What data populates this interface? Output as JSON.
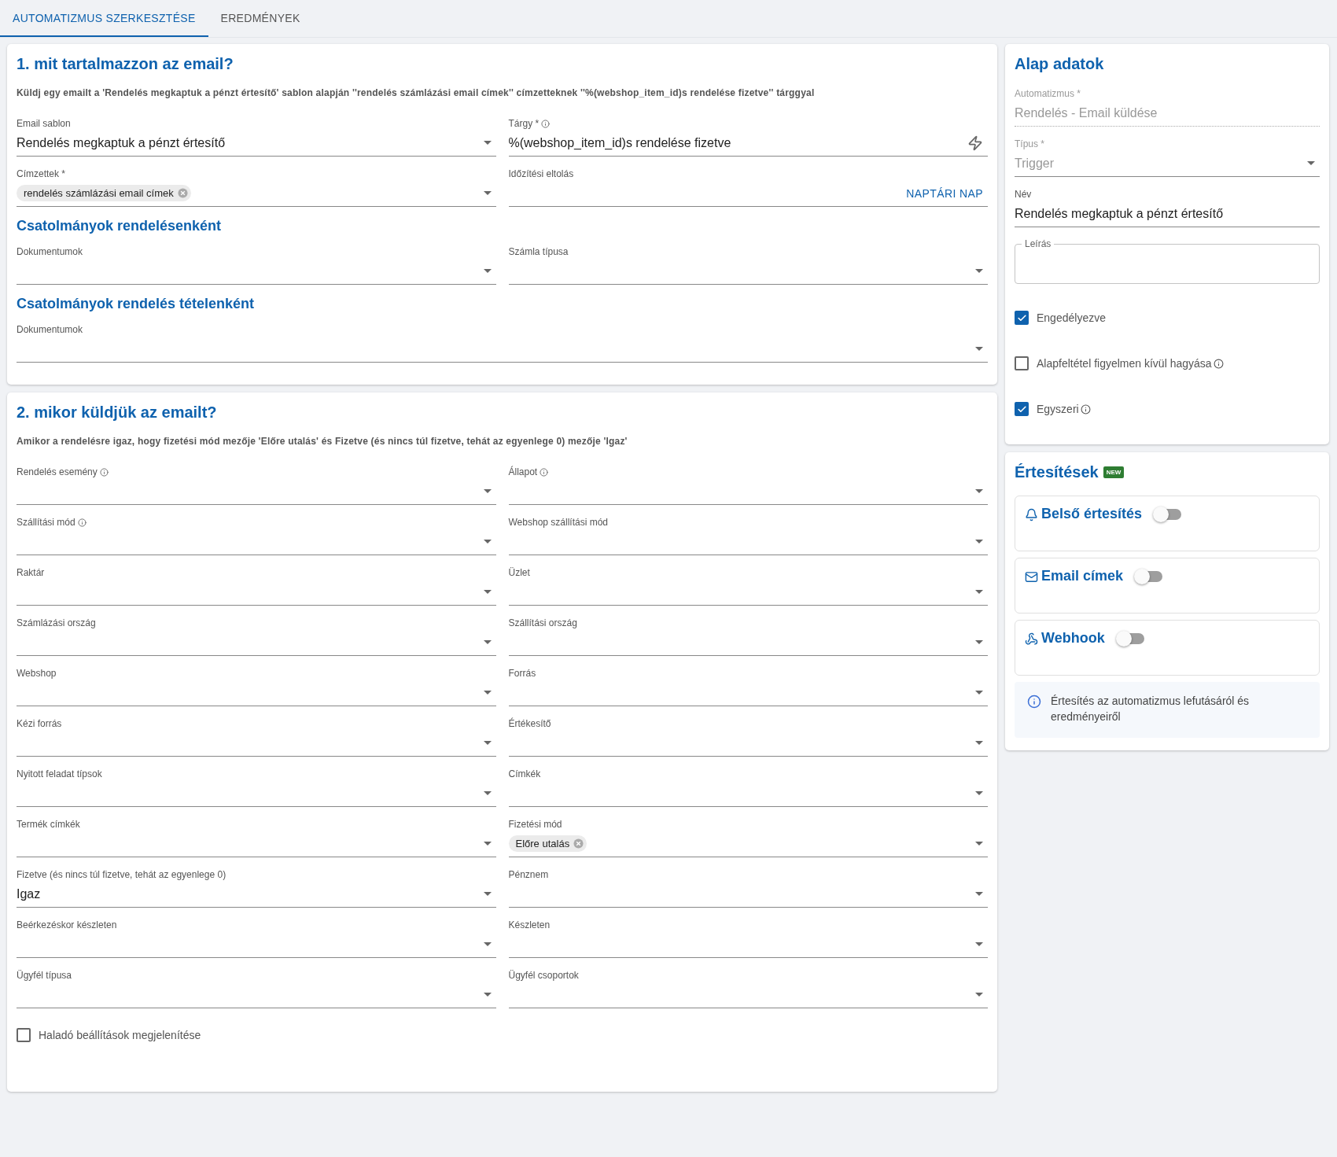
{
  "tabs": [
    {
      "label": "AUTOMATIZMUS SZERKESZTÉSE",
      "selected": true
    },
    {
      "label": "EREDMÉNYEK",
      "selected": false
    }
  ],
  "sections": [
    {
      "title": "1. mit tartalmazzon az email?",
      "description": "Küldj egy emailt a 'Rendelés megkaptuk a pénzt értesítő' sablon alapján ''rendelés számlázási email címek'' címzetteknek ''%(webshop_item_id)s rendelése fizetve'' tárggyal",
      "items": [
        {
          "kind": "row",
          "fields": [
            {
              "kind": "select",
              "label": "Email sablon",
              "value": "Rendelés megkaptuk a pénzt értesítő"
            },
            {
              "kind": "text",
              "label": "Tárgy *",
              "info": true,
              "value": "%(webshop_item_id)s rendelése fizetve"
            }
          ]
        },
        {
          "kind": "row",
          "fields": [
            {
              "kind": "chips",
              "label": "Címzettek *",
              "chips": [
                "rendelés számlázási email címek"
              ]
            },
            {
              "kind": "offset",
              "label": "Időzítési eltolás",
              "action": "NAPTÁRI NAP"
            }
          ]
        },
        {
          "kind": "subheading",
          "text": "Csatolmányok rendelésenként"
        },
        {
          "kind": "row",
          "fields": [
            {
              "kind": "select",
              "label": "Dokumentumok"
            },
            {
              "kind": "select",
              "label": "Számla típusa"
            }
          ]
        },
        {
          "kind": "subheading",
          "text": "Csatolmányok rendelés tételenként"
        },
        {
          "kind": "row",
          "fields": [
            {
              "kind": "select",
              "label": "Dokumentumok"
            }
          ]
        }
      ]
    },
    {
      "title": "2. mikor küldjük az emailt?",
      "description": "Amikor a rendelésre igaz, hogy fizetési mód mezője 'Előre utalás' és Fizetve (és nincs túl fizetve, tehát az egyenlege 0) mezője 'Igaz'",
      "items": [
        {
          "kind": "row",
          "fields": [
            {
              "kind": "select",
              "label": "Rendelés esemény",
              "info": true
            },
            {
              "kind": "select",
              "label": "Állapot",
              "info": true
            }
          ]
        },
        {
          "kind": "row",
          "fields": [
            {
              "kind": "select",
              "label": "Szállítási mód",
              "info": true
            },
            {
              "kind": "select",
              "label": "Webshop szállítási mód"
            }
          ]
        },
        {
          "kind": "row",
          "fields": [
            {
              "kind": "select",
              "label": "Raktár"
            },
            {
              "kind": "select",
              "label": "Üzlet"
            }
          ]
        },
        {
          "kind": "row",
          "fields": [
            {
              "kind": "select",
              "label": "Számlázási ország"
            },
            {
              "kind": "select",
              "label": "Szállítási ország"
            }
          ]
        },
        {
          "kind": "row",
          "fields": [
            {
              "kind": "select",
              "label": "Webshop"
            },
            {
              "kind": "select",
              "label": "Forrás"
            }
          ]
        },
        {
          "kind": "row",
          "fields": [
            {
              "kind": "select",
              "label": "Kézi forrás"
            },
            {
              "kind": "select",
              "label": "Értékesítő"
            }
          ]
        },
        {
          "kind": "row",
          "fields": [
            {
              "kind": "select",
              "label": "Nyitott feladat típsok"
            },
            {
              "kind": "select",
              "label": "Címkék"
            }
          ]
        },
        {
          "kind": "row",
          "fields": [
            {
              "kind": "select",
              "label": "Termék címkék"
            },
            {
              "kind": "chips",
              "label": "Fizetési mód",
              "chips": [
                "Előre utalás"
              ]
            }
          ]
        },
        {
          "kind": "row",
          "fields": [
            {
              "kind": "select",
              "label": "Fizetve (és nincs túl fizetve, tehát az egyenlege 0)",
              "value": "Igaz"
            },
            {
              "kind": "select",
              "label": "Pénznem"
            }
          ]
        },
        {
          "kind": "row",
          "fields": [
            {
              "kind": "select",
              "label": "Beérkezéskor készleten"
            },
            {
              "kind": "select",
              "label": "Készleten"
            }
          ]
        },
        {
          "kind": "row",
          "fields": [
            {
              "kind": "select",
              "label": "Ügyfél típusa"
            },
            {
              "kind": "select",
              "label": "Ügyfél csoportok"
            }
          ]
        },
        {
          "kind": "checkbox",
          "label": "Haladó beállítások megjelenítése",
          "checked": false
        }
      ]
    }
  ],
  "basic": {
    "title": "Alap adatok",
    "fields": [
      {
        "kind": "readonly",
        "label": "Automatizmus *",
        "value": "Rendelés - Email küldése"
      },
      {
        "kind": "disabled-select",
        "label": "Típus *",
        "value": "Trigger"
      },
      {
        "kind": "text",
        "label": "Név",
        "value": "Rendelés megkaptuk a pénzt értesítő"
      },
      {
        "kind": "outlined",
        "label": "Leírás"
      }
    ],
    "checkboxes": [
      {
        "label": "Engedélyezve",
        "checked": true
      },
      {
        "label": "Alapfeltétel figyelmen kívül hagyása",
        "checked": false,
        "info": true
      },
      {
        "label": "Egyszeri",
        "checked": true,
        "info": true
      }
    ]
  },
  "notifications": {
    "title": "Értesítések",
    "badge": "NEW",
    "channels": [
      {
        "kind": "bell",
        "label": "Belső értesítés",
        "on": false
      },
      {
        "kind": "mail",
        "label": "Email címek",
        "on": false
      },
      {
        "kind": "webhook",
        "label": "Webhook",
        "on": false
      }
    ],
    "note": "Értesítés az automatizmus lefutásáról és eredményeiről"
  }
}
